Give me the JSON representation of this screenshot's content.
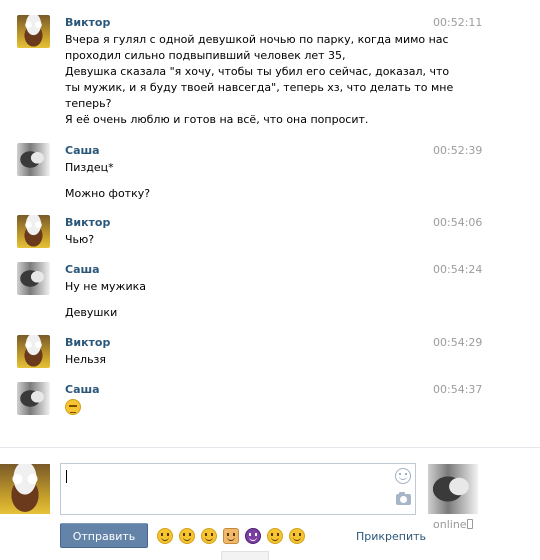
{
  "messages": [
    {
      "author": "Виктор",
      "time": "00:52:11",
      "avatar": "viktor",
      "lines": [
        "Вчера я гулял с одной девушкой ночью по парку, когда мимо нас",
        "проходил сильно подвыпивший человек лет 35,",
        "Девушка сказала \"я хочу, чтобы ты убил его сейчас, доказал, что",
        "ты мужик, и я буду твоей навсегда\", теперь хз, что делать то мне",
        "теперь?",
        "Я её очень люблю и готов на всё, что она попросит."
      ]
    },
    {
      "author": "Саша",
      "time": "00:52:39",
      "avatar": "sasha",
      "lines": [
        "Пиздец*",
        "",
        "Можно фотку?"
      ]
    },
    {
      "author": "Виктор",
      "time": "00:54:06",
      "avatar": "viktor",
      "lines": [
        "Чью?"
      ]
    },
    {
      "author": "Саша",
      "time": "00:54:24",
      "avatar": "sasha",
      "lines": [
        "Ну не мужика",
        "",
        "Девушки"
      ]
    },
    {
      "author": "Виктор",
      "time": "00:54:29",
      "avatar": "viktor",
      "lines": [
        "Нельзя"
      ]
    },
    {
      "author": "Саша",
      "time": "00:54:37",
      "avatar": "sasha",
      "lines": [],
      "emoji": "relieved-face-emoji"
    }
  ],
  "composer": {
    "value": "",
    "send_label": "Отправить",
    "attach_label": "Прикрепить",
    "quick_emojis": [
      "smirk-emoji",
      "dizzy-face-emoji",
      "grin-emoji",
      "thumbs-up-emoji",
      "devil-emoji",
      "weary-emoji",
      "smile-emoji"
    ]
  },
  "partner": {
    "status": "online"
  },
  "colors": {
    "name": "#2b587a",
    "time": "#9d9d9d",
    "button": "#6383a8"
  }
}
